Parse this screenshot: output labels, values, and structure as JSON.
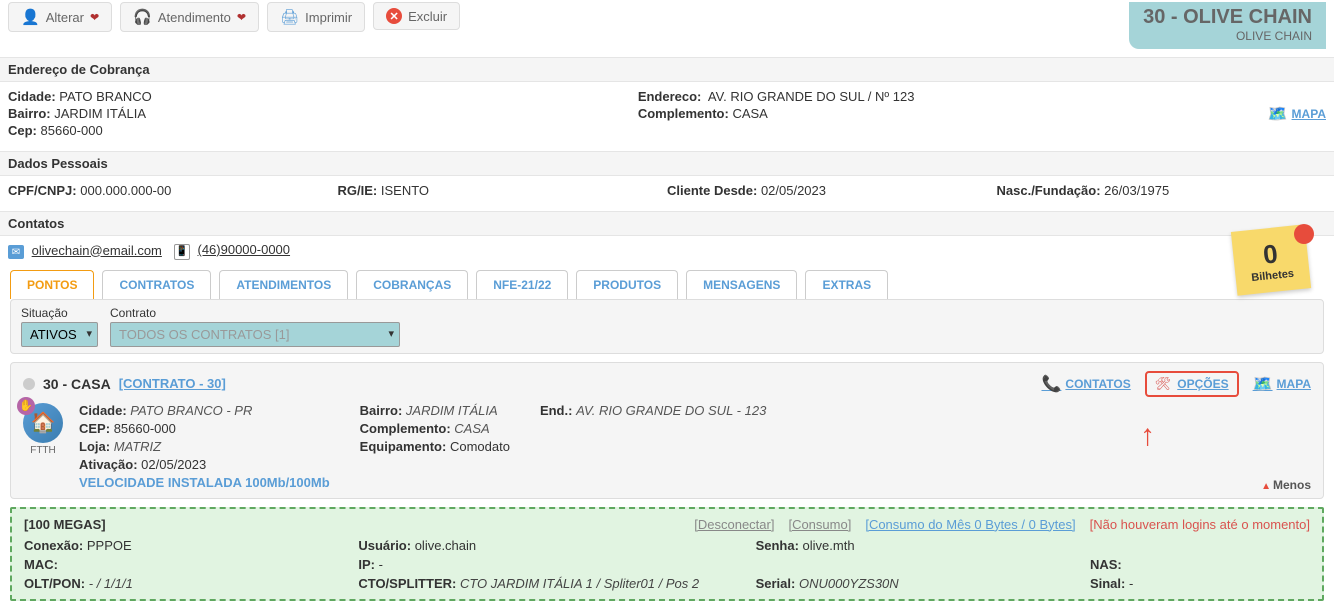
{
  "toolbar": {
    "alterar": "Alterar",
    "atendimento": "Atendimento",
    "imprimir": "Imprimir",
    "excluir": "Excluir"
  },
  "header": {
    "main": "30 - OLIVE CHAIN",
    "sub": "OLIVE CHAIN"
  },
  "sections": {
    "endereco_title": "Endereço de Cobrança",
    "dados_title": "Dados Pessoais",
    "contatos_title": "Contatos"
  },
  "endereco": {
    "cidade_lbl": "Cidade:",
    "cidade": "PATO BRANCO",
    "bairro_lbl": "Bairro:",
    "bairro": "JARDIM ITÁLIA",
    "cep_lbl": "Cep:",
    "cep": "85660-000",
    "endereco_lbl": "Endereco:",
    "endereco": "AV. RIO GRANDE DO SUL / Nº 123",
    "complemento_lbl": "Complemento:",
    "complemento": "CASA",
    "mapa": "MAPA"
  },
  "dados": {
    "cpf_lbl": "CPF/CNPJ:",
    "cpf": "000.000.000-00",
    "rg_lbl": "RG/IE:",
    "rg": "ISENTO",
    "desde_lbl": "Cliente Desde:",
    "desde": "02/05/2023",
    "nasc_lbl": "Nasc./Fundação:",
    "nasc": "26/03/1975"
  },
  "contatos": {
    "email": "olivechain@email.com",
    "phone": "(46)90000-0000"
  },
  "sticky": {
    "num": "0",
    "label": "Bilhetes"
  },
  "tabs": [
    "PONTOS",
    "CONTRATOS",
    "ATENDIMENTOS",
    "COBRANÇAS",
    "NFE-21/22",
    "PRODUTOS",
    "MENSAGENS",
    "EXTRAS"
  ],
  "filters": {
    "situacao_lbl": "Situação",
    "situacao_val": "ATIVOS",
    "contrato_lbl": "Contrato",
    "contrato_val": "TODOS OS CONTRATOS [1]"
  },
  "contract": {
    "title": "30 - CASA",
    "link": "[CONTRATO - 30]",
    "actions": {
      "contatos": "CONTATOS",
      "opcoes": "OPÇÕES",
      "mapa": "MAPA"
    },
    "ftth": "FTTH",
    "menos": "Menos",
    "cidade_lbl": "Cidade:",
    "cidade": "PATO BRANCO - PR",
    "cep_lbl": "CEP:",
    "cep": "85660-000",
    "loja_lbl": "Loja:",
    "loja": "MATRIZ",
    "ativ_lbl": "Ativação:",
    "ativ": "02/05/2023",
    "speed": "VELOCIDADE INSTALADA 100Mb/100Mb",
    "bairro_lbl": "Bairro:",
    "bairro": "JARDIM ITÁLIA",
    "compl_lbl": "Complemento:",
    "compl": "CASA",
    "equip_lbl": "Equipamento:",
    "equip": "Comodato",
    "end_lbl": "End.:",
    "end": "AV. RIO GRANDE DO SUL - 123"
  },
  "conn": {
    "megas": "[100 MEGAS]",
    "desconectar": "[Desconectar]",
    "consumo": "[Consumo]",
    "consumo_mes": "[Consumo do Mês 0 Bytes / 0 Bytes]",
    "no_login": "[Não houveram logins até o momento]",
    "conexao_lbl": "Conexão:",
    "conexao": "PPPOE",
    "usuario_lbl": "Usuário:",
    "usuario": "olive.chain",
    "senha_lbl": "Senha:",
    "senha": "olive.mth",
    "mac_lbl": "MAC:",
    "mac": "",
    "ip_lbl": "IP:",
    "ip": "-",
    "nas_lbl": "NAS:",
    "nas": "",
    "olt_lbl": "OLT/PON:",
    "olt": "- / 1/1/1",
    "cto_lbl": "CTO/SPLITTER:",
    "cto": "CTO JARDIM ITÁLIA 1 / Spliter01 / Pos 2",
    "serial_lbl": "Serial:",
    "serial": "ONU000YZS30N",
    "sinal_lbl": "Sinal:",
    "sinal": "-"
  }
}
